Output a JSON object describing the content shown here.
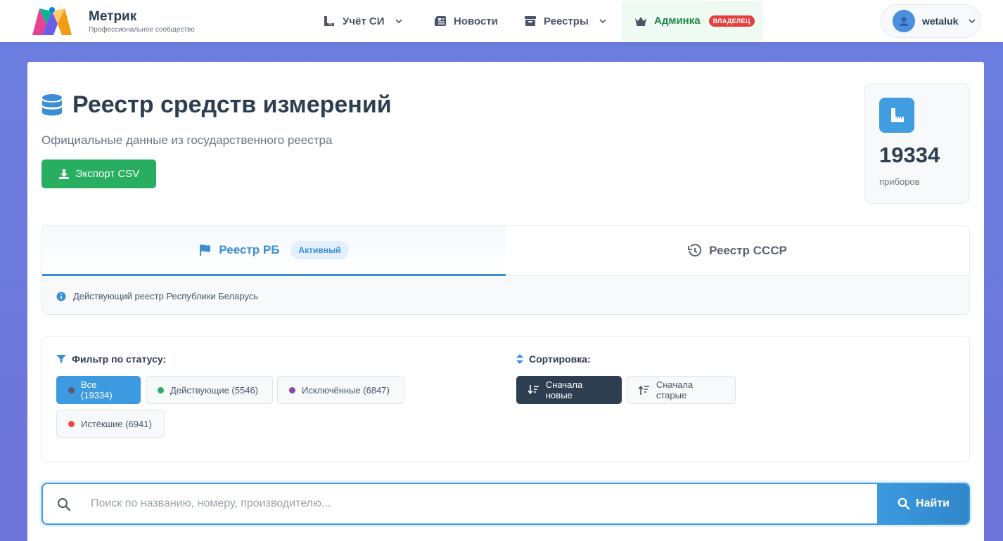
{
  "brand": {
    "title": "Метрик",
    "subtitle": "Профессиональное сообщество",
    "logo_icon": "m-logo-icon"
  },
  "nav": {
    "items": [
      {
        "label": "Учёт СИ",
        "icon": "ruler-icon",
        "dropdown": true
      },
      {
        "label": "Новости",
        "icon": "newspaper-icon",
        "dropdown": false
      },
      {
        "label": "Реестры",
        "icon": "archive-icon",
        "dropdown": true
      }
    ],
    "admin": {
      "label": "Админка",
      "icon": "crown-icon",
      "badge": "ВЛАДЕЛЕЦ"
    }
  },
  "user": {
    "name": "wetaluk",
    "icon": "user-icon"
  },
  "page": {
    "title": "Реестр средств измерений",
    "title_icon": "database-icon",
    "subtitle": "Официальные данные из государственного реестра",
    "export_label": "Экспорт CSV"
  },
  "stats": {
    "value": "19334",
    "label": "приборов",
    "icon": "ruler-icon"
  },
  "tabs": [
    {
      "label": "Реестр РБ",
      "icon": "flag-icon",
      "badge": "Активный",
      "active": true
    },
    {
      "label": "Реестр СССР",
      "icon": "history-icon",
      "active": false
    }
  ],
  "tab_info": "Действующий реестр Республики Беларусь",
  "filters": {
    "status_label": "Фильтр по статусу:",
    "statuses": [
      {
        "label": "Все (19334)",
        "color": "#555e68",
        "active": true
      },
      {
        "label": "Действующие (5546)",
        "color": "#27ae60",
        "active": false
      },
      {
        "label": "Исключённые (6847)",
        "color": "#8e44ad",
        "active": false
      },
      {
        "label": "Истёкшие (6941)",
        "color": "#e74c3c",
        "active": false
      }
    ],
    "sort_label": "Сортировка:",
    "sorts": [
      {
        "label": "Сначала новые",
        "icon": "sort-desc-icon",
        "active": true
      },
      {
        "label": "Сначала старые",
        "icon": "sort-asc-icon",
        "active": false
      }
    ]
  },
  "search": {
    "placeholder": "Поиск по названию, номеру, производителю...",
    "value": "",
    "button_label": "Найти"
  },
  "colors": {
    "accent": "#3d9ae0",
    "success": "#27ae60",
    "dark": "#2c3e50",
    "danger": "#e53e3e",
    "background": "#6b7fe0"
  }
}
